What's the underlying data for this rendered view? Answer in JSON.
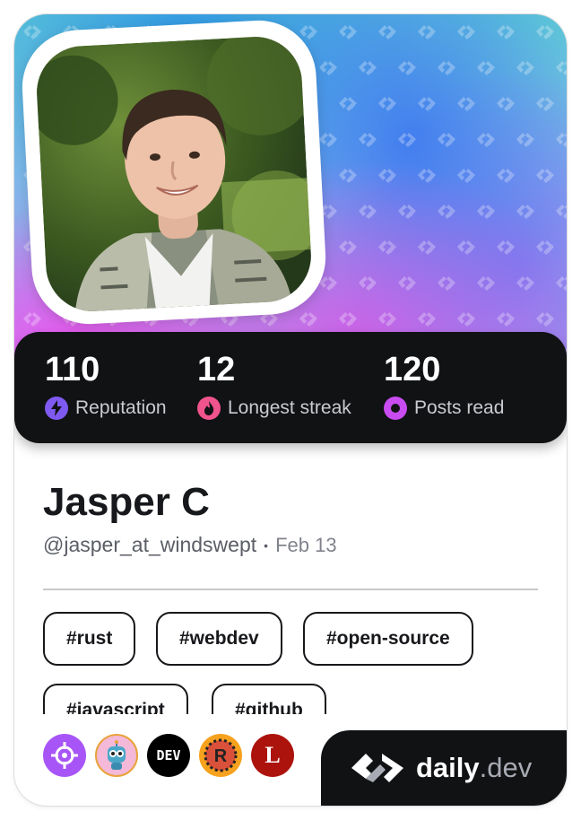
{
  "profile": {
    "name": "Jasper C",
    "handle": "@jasper_at_windswept",
    "separator": "•",
    "joined": "Feb 13"
  },
  "stats": [
    {
      "value": "110",
      "label": "Reputation",
      "icon": "lightning-icon",
      "color": "#7f5af0"
    },
    {
      "value": "12",
      "label": "Longest streak",
      "icon": "flame-icon",
      "color": "#f0548c"
    },
    {
      "value": "120",
      "label": "Posts read",
      "icon": "eye-icon",
      "color": "#c84cf0"
    }
  ],
  "tags": [
    "#rust",
    "#webdev",
    "#open-source",
    "#javascript",
    "#github"
  ],
  "badges": [
    {
      "name": "target-badge-icon",
      "color": "#a855f7"
    },
    {
      "name": "robot-badge-icon",
      "color": "#f4b8d8"
    },
    {
      "name": "dev-badge-icon",
      "color": "#000000",
      "text": "DEV"
    },
    {
      "name": "rust-badge-icon",
      "color": "#d9513a"
    },
    {
      "name": "lobsters-badge-icon",
      "color": "#ac130d",
      "text": "L"
    }
  ],
  "brand": {
    "name": "daily",
    "ext": ".dev"
  },
  "colors": {
    "accent_dark": "#111214",
    "text_primary": "#17181b"
  }
}
